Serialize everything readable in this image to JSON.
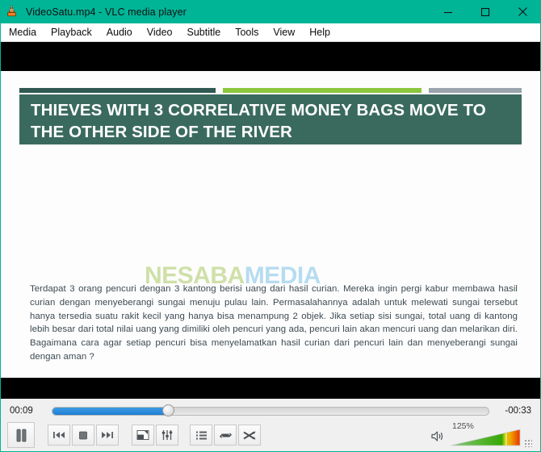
{
  "window": {
    "title": "VideoSatu.mp4 - VLC media player",
    "app_icon": "vlc-cone-icon",
    "titlebar_color": "#00b496",
    "minimize_label": "–",
    "maximize_label": "□",
    "close_label": "✕"
  },
  "menubar": {
    "items": [
      {
        "label": "Media"
      },
      {
        "label": "Playback"
      },
      {
        "label": "Audio"
      },
      {
        "label": "Video"
      },
      {
        "label": "Subtitle"
      },
      {
        "label": "Tools"
      },
      {
        "label": "View"
      },
      {
        "label": "Help"
      }
    ]
  },
  "video": {
    "background": "#000000",
    "slide": {
      "background": "#fdfdfd",
      "accent_bars": [
        {
          "name": "dark-green-bar",
          "color": "#2f5951"
        },
        {
          "name": "light-green-bar",
          "color": "#8cc63e"
        },
        {
          "name": "grey-bar",
          "color": "#9aa4ad"
        }
      ],
      "title_banner_color": "#3a6a5e",
      "title": "THIEVES WITH 3 CORRELATIVE MONEY BAGS MOVE TO THE OTHER SIDE OF THE RIVER",
      "watermark": {
        "part1": "NESABA",
        "part2": "MEDIA",
        "color1": "#cfe0a8",
        "color2": "#b6dcf0"
      },
      "body": "Terdapat 3 orang pencuri dengan 3 kantong berisi uang dari hasil curian. Mereka ingin pergi kabur membawa hasil curian dengan menyeberangi sungai menuju pulau lain. Permasalahannya adalah untuk melewati sungai tersebut hanya tersedia suatu rakit kecil yang hanya bisa menampung 2 objek. Jika setiap sisi sungai, total uang di kantong lebih besar dari total nilai uang yang dimiliki oleh pencuri yang ada, pencuri lain akan mencuri uang dan melarikan diri. Bagaimana cara agar setiap pencuri bisa menyelamatkan hasil curian dari pencuri lain dan menyeberangi sungai dengan aman ?"
    }
  },
  "controls": {
    "time_elapsed": "00:09",
    "time_remaining": "-00:33",
    "seek_percent": 26.5,
    "seek_fill_color": "#2483da",
    "buttons": [
      {
        "name": "pause-button",
        "label": "Pause"
      },
      {
        "name": "previous-button",
        "label": "Previous"
      },
      {
        "name": "stop-button",
        "label": "Stop"
      },
      {
        "name": "next-button",
        "label": "Next"
      },
      {
        "name": "fullscreen-button",
        "label": "Toggle fullscreen"
      },
      {
        "name": "extended-settings-button",
        "label": "Show extended settings"
      },
      {
        "name": "playlist-button",
        "label": "Show playlist"
      },
      {
        "name": "loop-button",
        "label": "Loop"
      },
      {
        "name": "random-button",
        "label": "Random"
      }
    ],
    "volume": {
      "percent_label": "125%",
      "value": 125,
      "mute_icon": "speaker-icon"
    }
  }
}
